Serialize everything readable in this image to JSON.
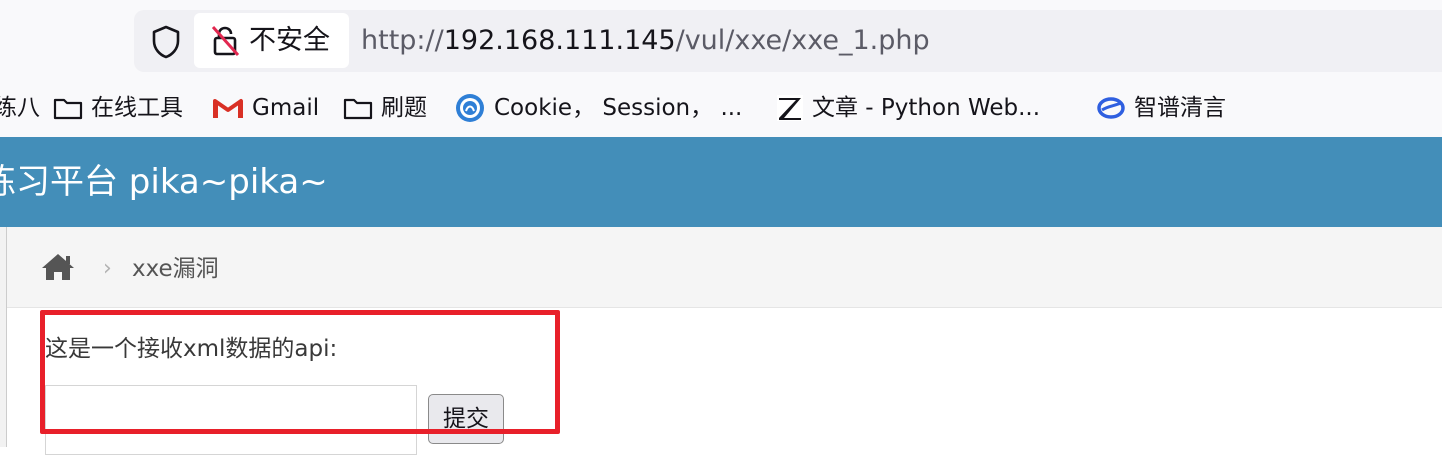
{
  "browser": {
    "security_label": "不安全",
    "url_scheme": "http://",
    "url_host": "192.168.111.145",
    "url_path": "/vul/xxe/xxe_1.php",
    "icons": [
      "shield-icon",
      "insecure-lock-icon"
    ]
  },
  "bookmarks": {
    "items": [
      {
        "label": "练八",
        "icon": "none"
      },
      {
        "label": "在线工具",
        "icon": "folder-icon"
      },
      {
        "label": "Gmail",
        "icon": "gmail-icon"
      },
      {
        "label": "刷题",
        "icon": "folder-icon"
      },
      {
        "label": "Cookie， Session， ...",
        "icon": "site-globe-icon"
      },
      {
        "label": "文章 - Python Web...",
        "icon": "zhihu-z-icon"
      },
      {
        "label": "智谱清言",
        "icon": "zhipu-logo-icon"
      }
    ]
  },
  "header": {
    "title": "练习平台 pika~pika~",
    "background": "#438eb9"
  },
  "breadcrumb": {
    "separator": "›",
    "current": "xxe漏洞"
  },
  "form": {
    "label": "这是一个接收xml数据的api:",
    "input_value": "",
    "submit_label": "提交"
  },
  "annotation": {
    "color": "#e8202a"
  }
}
